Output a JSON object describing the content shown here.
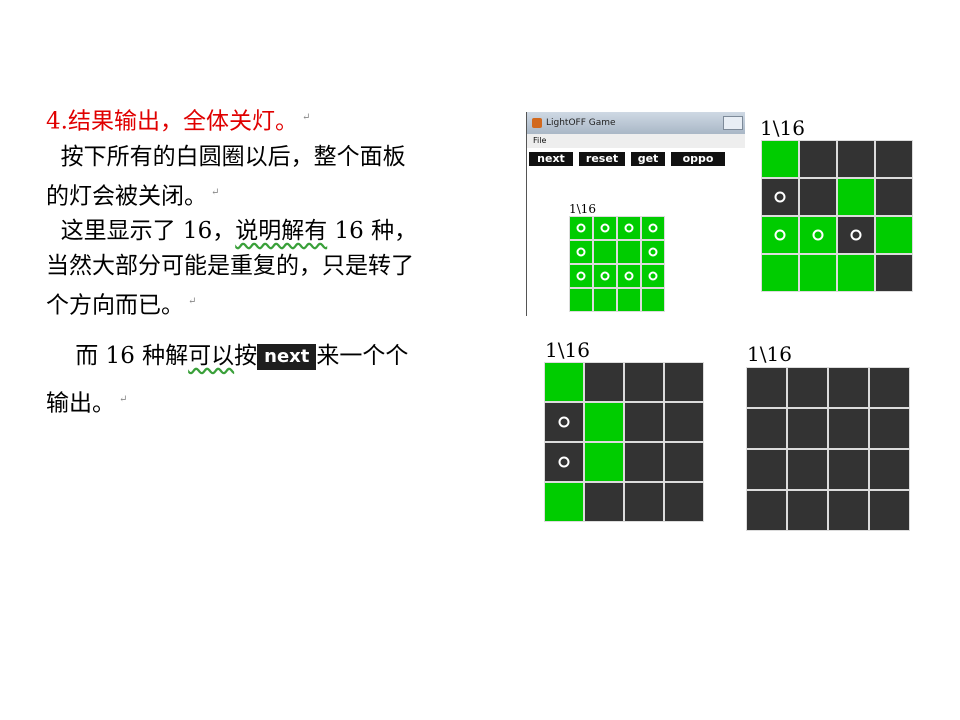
{
  "text": {
    "heading_num": "4.",
    "heading_text": "结果输出，全体关灯。",
    "p1_l1": "按下所有的白圆圈以后，整个面板",
    "p1_l2": "的灯会被关闭。",
    "p2_l1_a": "这里显示了 16，",
    "p2_l1_b": "说明解有",
    "p2_l1_c": " 16 种，",
    "p2_l2": "当然大部分可能是重复的，只是转了",
    "p2_l3": "个方向而已。",
    "p3_a": "而 16 种解",
    "p3_b": "可以",
    "p3_c": "按",
    "p3_d": "来一个个",
    "p3_l2": "输出。",
    "return_mark": "↵",
    "inline_next": "next"
  },
  "window": {
    "title": "LightOFF Game",
    "menu_file": "File",
    "buttons": [
      "next",
      "reset",
      "get",
      "oppo"
    ],
    "counter": "1\\16",
    "grid": [
      [
        2,
        2,
        2,
        2
      ],
      [
        2,
        0,
        0,
        2
      ],
      [
        2,
        2,
        2,
        2
      ],
      [
        0,
        0,
        0,
        0
      ]
    ]
  },
  "panels": [
    {
      "counter": "1\\16",
      "grid": [
        [
          1,
          0,
          0,
          0
        ],
        [
          2,
          0,
          1,
          0
        ],
        [
          3,
          3,
          2,
          1
        ],
        [
          1,
          1,
          1,
          0
        ]
      ]
    },
    {
      "counter": "1\\16",
      "grid": [
        [
          1,
          0,
          0,
          0
        ],
        [
          2,
          1,
          0,
          0
        ],
        [
          2,
          1,
          0,
          0
        ],
        [
          1,
          0,
          0,
          0
        ]
      ]
    },
    {
      "counter": "1\\16",
      "grid": [
        [
          0,
          0,
          0,
          0
        ],
        [
          0,
          0,
          0,
          0
        ],
        [
          0,
          0,
          0,
          0
        ],
        [
          0,
          0,
          0,
          0
        ]
      ]
    }
  ],
  "legend": {
    "cell_states": "0 off, 1 on, 2 off with circle, 3 on with circle"
  },
  "colors": {
    "on": "#00cc00",
    "off": "#333333",
    "heading": "#e00000"
  }
}
